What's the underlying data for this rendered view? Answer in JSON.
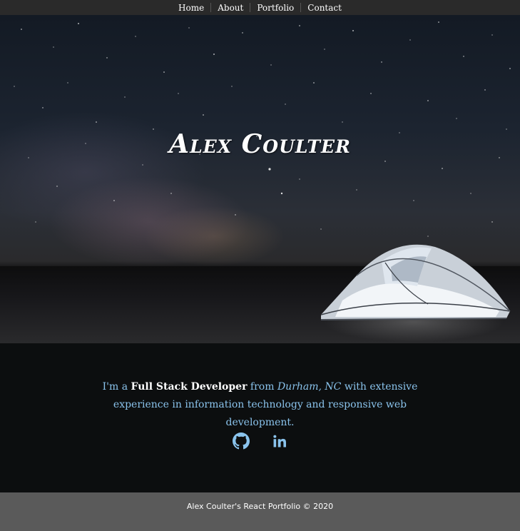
{
  "nav": {
    "items": [
      {
        "label": "Home"
      },
      {
        "label": "About"
      },
      {
        "label": "Portfolio"
      },
      {
        "label": "Contact"
      }
    ]
  },
  "hero": {
    "title": "Alex Coulter"
  },
  "about": {
    "intro": "I'm a",
    "role": "Full Stack Developer",
    "from": "from",
    "location": "Durham, NC",
    "rest": "with extensive experience in information technology and responsive web development."
  },
  "social": {
    "items": [
      {
        "icon": "github-icon"
      },
      {
        "icon": "linkedin-icon"
      }
    ],
    "color": "#8ac3ec"
  },
  "footer": {
    "text": "Alex Coulter's React Portfolio © 2020"
  }
}
